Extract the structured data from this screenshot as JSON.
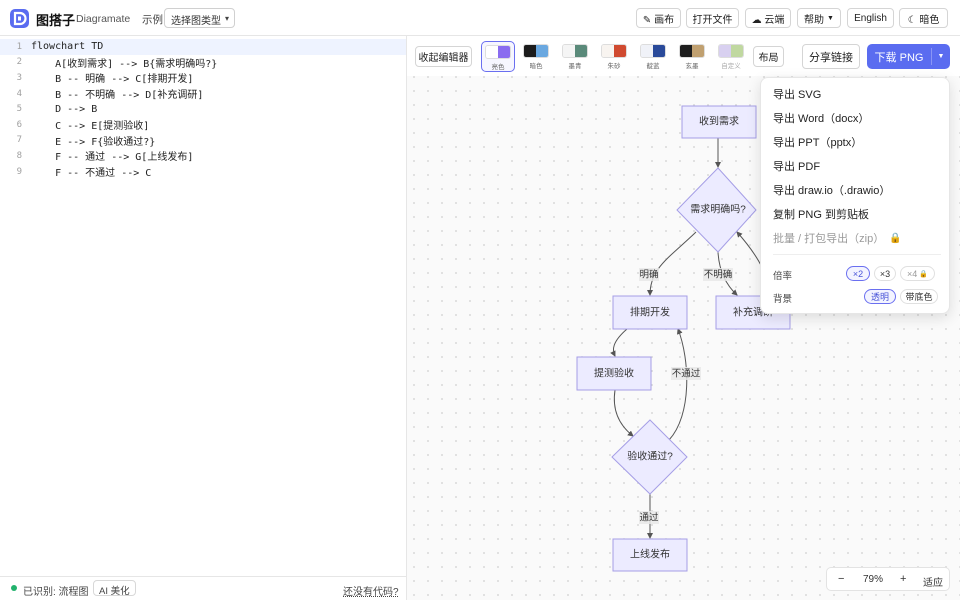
{
  "app": {
    "name": "图搭子",
    "name_en": "Diagramate"
  },
  "header": {
    "example_label": "示例",
    "type_select": "选择图类型",
    "canvas_btn": "✎ 画布",
    "open_file_btn": "打开文件",
    "cloud_btn": "☁ 云端",
    "help_btn": "帮助",
    "lang_btn": "English",
    "theme_btn": "☾ 暗色"
  },
  "editor": {
    "lines": [
      {
        "n": "1",
        "text": "flowchart TD"
      },
      {
        "n": "2",
        "text": "    A[收到需求] --> B{需求明确吗?}"
      },
      {
        "n": "3",
        "text": "    B -- 明确 --> C[排期开发]"
      },
      {
        "n": "4",
        "text": "    B -- 不明确 --> D[补充调研]"
      },
      {
        "n": "5",
        "text": "    D --> B"
      },
      {
        "n": "6",
        "text": "    C --> E[提测验收]"
      },
      {
        "n": "7",
        "text": "    E --> F{验收通过?}"
      },
      {
        "n": "8",
        "text": "    F -- 通过 --> G[上线发布]"
      },
      {
        "n": "9",
        "text": "    F -- 不通过 --> C"
      }
    ],
    "status": "已识别: 流程图",
    "ai_btn": "AI 美化",
    "no_code_link": "还没有代码?"
  },
  "toolbar": {
    "collapse_btn": "收起编辑器",
    "themes": [
      {
        "label": "亮色",
        "c1": "#ffffff",
        "c2": "#8a6cf0"
      },
      {
        "label": "暗色",
        "c1": "#1c1c1c",
        "c2": "#6aa8e0"
      },
      {
        "label": "墨青",
        "c1": "#f5f5f5",
        "c2": "#5a8a7a"
      },
      {
        "label": "朱砂",
        "c1": "#f8f4f0",
        "c2": "#d04a30"
      },
      {
        "label": "靛蓝",
        "c1": "#f0f2f8",
        "c2": "#2a4a9a"
      },
      {
        "label": "玄墨",
        "c1": "#1e1e1e",
        "c2": "#c0a070"
      },
      {
        "label": "自定义",
        "c1": "#d8d0f0",
        "c2": "#c0d8a0"
      }
    ],
    "layout_btn": "布局",
    "share_btn": "分享链接",
    "download_btn": "下载 PNG"
  },
  "export_menu": {
    "items": [
      "导出 SVG",
      "导出 Word（docx）",
      "导出 PPT（pptx）",
      "导出 PDF",
      "导出 draw.io（.drawio）",
      "复制 PNG 到剪贴板"
    ],
    "batch": "批量 / 打包导出（zip）",
    "scale_label": "倍率",
    "scales": [
      "×2",
      "×3",
      "×4"
    ],
    "bg_label": "背景",
    "bg_options": [
      "透明",
      "带底色"
    ]
  },
  "diagram": {
    "nodes": {
      "A": "收到需求",
      "B": "需求明确吗?",
      "C": "排期开发",
      "D": "补充调研",
      "E": "提测验收",
      "F": "验收通过?",
      "G": "上线发布"
    },
    "edges": {
      "b_c": "明确",
      "b_d": "不明确",
      "f_g": "通过",
      "f_c": "不通过"
    }
  },
  "zoom": {
    "minus": "−",
    "level": "79%",
    "plus": "+",
    "fit": "适应"
  },
  "colors": {
    "accent": "#5a6cf0",
    "node_fill": "#ecebff",
    "node_stroke": "#a59ee6"
  }
}
